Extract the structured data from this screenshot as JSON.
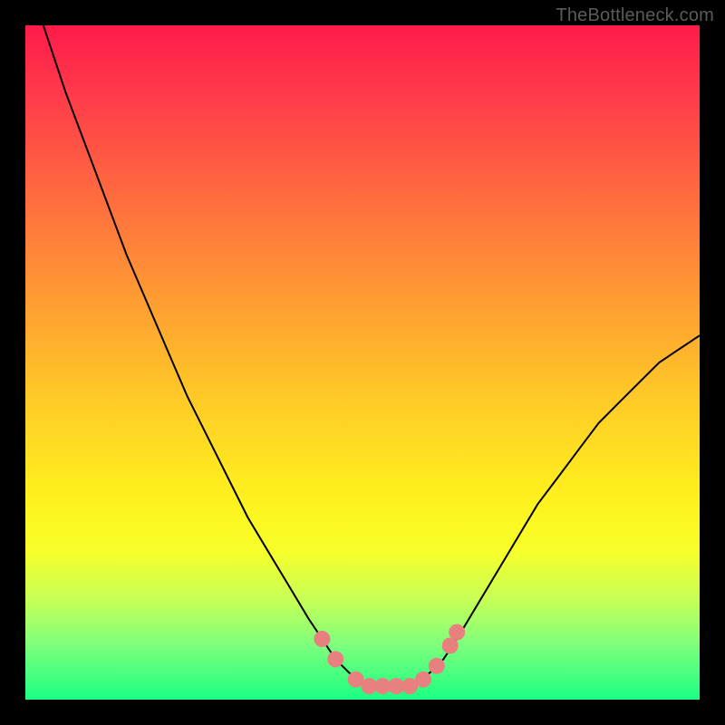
{
  "watermark": "TheBottleneck.com",
  "chart_data": {
    "type": "line",
    "title": "",
    "xlabel": "",
    "ylabel": "",
    "xlim": [
      0,
      100
    ],
    "ylim": [
      0,
      100
    ],
    "x": [
      0,
      3,
      6,
      9,
      12,
      15,
      18,
      21,
      24,
      27,
      30,
      33,
      36,
      39,
      42,
      44,
      46,
      48,
      50,
      52,
      54,
      56,
      58,
      60,
      62,
      64,
      67,
      70,
      73,
      76,
      79,
      82,
      85,
      88,
      91,
      94,
      97,
      100
    ],
    "series": [
      {
        "name": "bottleneck-curve",
        "values": [
          108,
          99,
          90,
          82,
          74,
          66,
          59,
          52,
          45,
          39,
          33,
          27,
          22,
          17,
          12,
          9,
          6,
          4,
          2.5,
          2,
          2,
          2,
          2.5,
          4,
          6,
          9,
          14,
          19,
          24,
          29,
          33,
          37,
          41,
          44,
          47,
          50,
          52,
          54
        ]
      }
    ],
    "marker_points": {
      "x": [
        44,
        46,
        49,
        51,
        53,
        55,
        57,
        59,
        61,
        63,
        64
      ],
      "y": [
        9,
        6,
        3,
        2,
        2,
        2,
        2,
        3,
        5,
        8,
        10
      ]
    },
    "colors": {
      "curve": "#000000",
      "markers": "#e98080",
      "gradient_top": "#ff1a4b",
      "gradient_mid": "#fff11d",
      "gradient_bottom": "#1aff82"
    }
  }
}
